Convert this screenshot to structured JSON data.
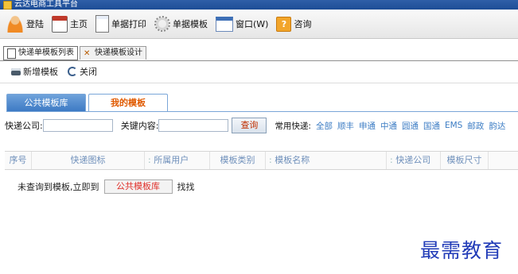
{
  "window": {
    "title": "云达电商工具平台"
  },
  "toolbar": {
    "items": [
      {
        "label": "登陆",
        "icon": "user-icon"
      },
      {
        "label": "主页",
        "icon": "calendar-icon"
      },
      {
        "label": "单据打印",
        "icon": "document-icon"
      },
      {
        "label": "单据模板",
        "icon": "gear-icon"
      },
      {
        "label": "窗口(W)",
        "icon": "window-icon"
      },
      {
        "label": "咨询",
        "icon": "help-icon"
      }
    ]
  },
  "doc_tabs": [
    {
      "label": "快递单模板列表"
    },
    {
      "label": "快递模板设计"
    }
  ],
  "subbar": {
    "add_label": "新增模板",
    "close_label": "关闭"
  },
  "template_tabs": {
    "public_label": "公共模板库",
    "mine_label": "我的模板"
  },
  "search": {
    "company_label": "快递公司:",
    "company_value": "",
    "keyword_label": "关键内容:",
    "keyword_value": "",
    "query_button": "查询",
    "common_label": "常用快递:",
    "common_items": [
      "全部",
      "顺丰",
      "申通",
      "中通",
      "圆通",
      "国通",
      "EMS",
      "邮政",
      "韵达"
    ]
  },
  "table": {
    "columns": [
      "序号",
      "快递图标",
      "所属用户",
      "模板类别",
      "模板名称",
      "快递公司",
      "模板尺寸"
    ]
  },
  "empty": {
    "prefix": "未查询到模板,立即到",
    "button": "公共模板库",
    "suffix": "找找"
  },
  "watermark": "最需教育",
  "colors": {
    "accent": "#3d7dc4",
    "active_tab_text": "#e05a00",
    "watermark": "#223cb8"
  }
}
